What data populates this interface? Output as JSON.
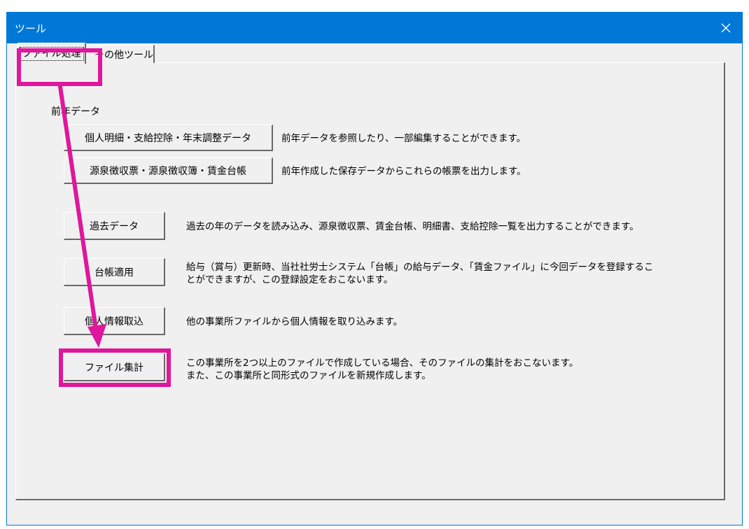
{
  "window": {
    "title": "ツール",
    "close_icon": "close-icon"
  },
  "tabs": [
    {
      "label": "ファイル処理",
      "active": true
    },
    {
      "label": "その他ツール",
      "active": false
    }
  ],
  "section": {
    "label": "前年データ"
  },
  "items": [
    {
      "button": "個人明細・支給控除・年末調整データ",
      "description": "前年データを参照したり、一部編集することができます。"
    },
    {
      "button": "源泉徴収票・源泉徴収簿・賃金台帳",
      "description": "前年作成した保存データからこれらの帳票を出力します。"
    },
    {
      "button": "過去データ",
      "description": "過去の年のデータを読み込み、源泉徴収票、賃金台帳、明細書、支給控除一覧を出力することができます。"
    },
    {
      "button": "台帳適用",
      "description_lines": [
        "給与（賞与）更新時、当社社労士システム「台帳」の給与データ、「賃金ファイル」に今回データを登録するこ",
        "とができますが、この登録設定をおこないます。"
      ]
    },
    {
      "button": "個人情報取込",
      "description": "他の事業所ファイルから個人情報を取り込みます。"
    },
    {
      "button": "ファイル集計",
      "description_lines": [
        "この事業所を2つ以上のファイルで作成している場合、そのファイルの集計をおこないます。",
        "また、この事業所と同形式のファイルを新規作成します。"
      ]
    }
  ],
  "colors": {
    "titlebar": "#0078d7",
    "highlight": "#e0169c",
    "face": "#f0f0f0"
  }
}
